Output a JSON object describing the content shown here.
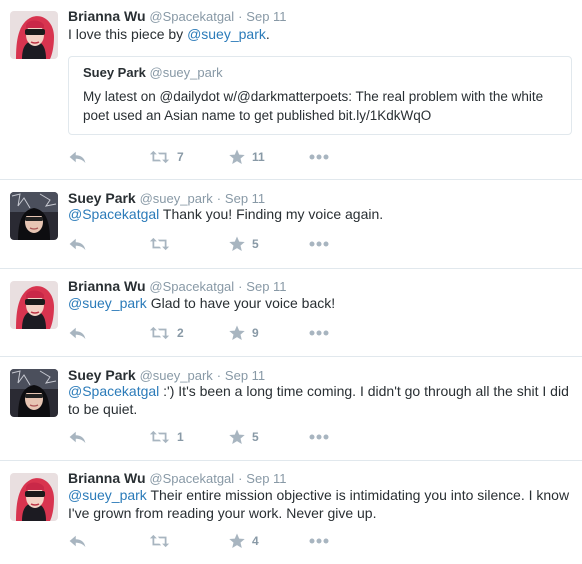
{
  "colors": {
    "link": "#2b7bb9",
    "muted": "#8899a6",
    "icon": "#a8b5c0",
    "border": "#e1e8ed"
  },
  "tweets": [
    {
      "name": "Brianna Wu",
      "handle": "@Spacekatgal",
      "dot": "·",
      "time": "Sep 11",
      "text_prefix": "I love this piece by ",
      "mention": "@suey_park",
      "text_suffix": ".",
      "quote": {
        "name": "Suey Park",
        "handle": "@suey_park",
        "text": "My latest on @dailydot w/@darkmatterpoets: The real problem with the white poet used an Asian name to get published bit.ly/1KdkWqO"
      },
      "retweets": "7",
      "likes": "11"
    },
    {
      "name": "Suey Park",
      "handle": "@suey_park",
      "dot": "·",
      "time": "Sep 11",
      "mention": "@Spacekatgal",
      "text": " Thank you! Finding my voice again.",
      "retweets": "",
      "likes": "5"
    },
    {
      "name": "Brianna Wu",
      "handle": "@Spacekatgal",
      "dot": "·",
      "time": "Sep 11",
      "mention": "@suey_park",
      "text": " Glad to have your voice back!",
      "retweets": "2",
      "likes": "9"
    },
    {
      "name": "Suey Park",
      "handle": "@suey_park",
      "dot": "·",
      "time": "Sep 11",
      "mention": "@Spacekatgal",
      "text": " :') It's been a long time coming. I didn't go through all the shit I did to be quiet.",
      "retweets": "1",
      "likes": "5"
    },
    {
      "name": "Brianna Wu",
      "handle": "@Spacekatgal",
      "dot": "·",
      "time": "Sep 11",
      "mention": "@suey_park",
      "text": " Their entire mission objective is intimidating you into silence. I know I've grown from reading your work. Never give up.",
      "retweets": "",
      "likes": "4"
    }
  ],
  "icons": {
    "reply": "reply-icon",
    "retweet": "retweet-icon",
    "like": "star-icon",
    "more": "more-icon"
  }
}
